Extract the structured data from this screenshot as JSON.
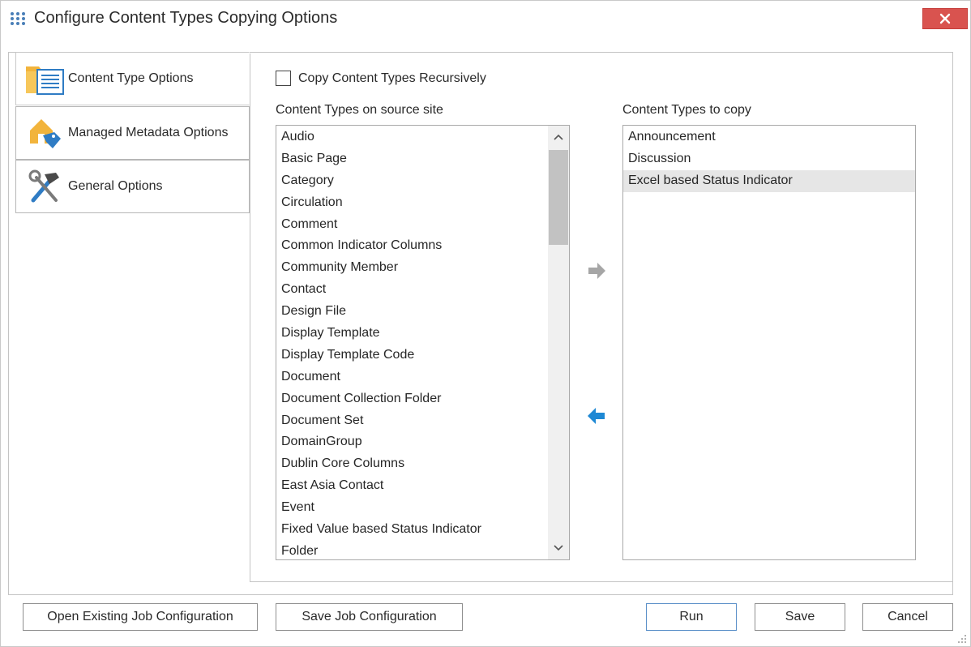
{
  "window": {
    "title": "Configure Content Types Copying Options",
    "close_label": "×"
  },
  "tabs": [
    {
      "label": "Content Type Options",
      "icon": "folder-list-icon",
      "active": true
    },
    {
      "label": "Managed Metadata Options",
      "icon": "home-tag-icon",
      "active": false
    },
    {
      "label": "General Options",
      "icon": "hammer-wrench-icon",
      "active": false
    }
  ],
  "options": {
    "recursive_label": "Copy Content Types Recursively",
    "recursive_checked": false
  },
  "source": {
    "label": "Content Types on source site",
    "items": [
      "Audio",
      "Basic Page",
      "Category",
      "Circulation",
      "Comment",
      "Common Indicator Columns",
      "Community Member",
      "Contact",
      "Design File",
      "Display Template",
      "Display Template Code",
      "Document",
      "Document Collection Folder",
      "Document Set",
      "DomainGroup",
      "Dublin Core Columns",
      "East Asia Contact",
      "Event",
      "Fixed Value based Status Indicator",
      "Folder"
    ]
  },
  "target": {
    "label": "Content Types to copy",
    "items": [
      "Announcement",
      "Discussion",
      "Excel based Status Indicator"
    ],
    "selected_index": 2
  },
  "colors": {
    "close": "#d9534f",
    "move_right_arrow": "#a6a6a6",
    "move_left_arrow": "#1e88d4"
  },
  "footer": {
    "open_config": "Open Existing Job Configuration",
    "save_config": "Save Job Configuration",
    "run": "Run",
    "save": "Save",
    "cancel": "Cancel"
  }
}
